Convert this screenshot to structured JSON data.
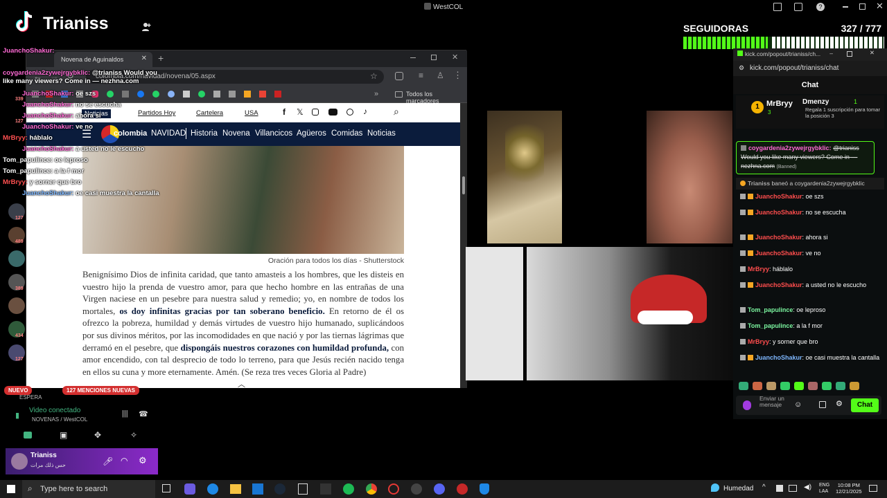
{
  "stream": {
    "channel_name": "Trianiss",
    "top_label": "WestCOL",
    "followers_label": "SEGUIDORAS",
    "followers_count": "327 / 777",
    "followers_progress": 0.42,
    "new_badge": "NUEVO",
    "mentions_badge": "127 MENCIONES NUEVAS",
    "overlay_chat": [
      {
        "user": "JuanchoShakur:",
        "text": ""
      },
      {
        "user": "coygardenia2zywejrgybklic:",
        "text": "@trianiss Would you like many viewers? Come in — nezhna.com"
      },
      {
        "user": "JuanchoShakur:",
        "text": "oe szs"
      },
      {
        "user": "JuanchoShakur:",
        "text": "no se escucha"
      },
      {
        "user": "JuanchoShakur:",
        "text": "ahora si"
      },
      {
        "user": "JuanchoShakur:",
        "text": "ve no"
      },
      {
        "user": "MrBryy:",
        "text": "háblalo"
      },
      {
        "user": "JuanchoShakur:",
        "text": "a usted no le escucho"
      },
      {
        "user": "Tom_papulince:",
        "text": "oe leproso"
      },
      {
        "user": "Tom_papulince:",
        "text": "a la f mor"
      },
      {
        "user": "MrBryy:",
        "text": "y sorner que bro"
      },
      {
        "user": "JuanchoShakur:",
        "text": "oe casi muestra la cantalla"
      }
    ],
    "viewer_counts": [
      "339",
      "127",
      "489",
      "127",
      "389",
      "434",
      "127"
    ]
  },
  "browser": {
    "tab_title": "Novena de Aguinaldos",
    "url": "colombia.com/navidad/novena/05.aspx",
    "all_bookmarks": "Todos los marcadores",
    "top_nav": [
      "Noticias",
      "Partidos Hoy",
      "Cartelera",
      "USA"
    ],
    "logo": "colombia",
    "main_nav": [
      "NAVIDAD",
      "Historia",
      "Novena",
      "Villancicos",
      "Agüeros",
      "Comidas",
      "Noticias"
    ],
    "caption": "Oración para todos los días - Shutterstock",
    "paragraph_1": "Benignísimo Dios de infinita caridad, que tanto amasteis a los hombres, que les disteis en vuestro hijo la prenda de vuestro amor, para que hecho hombre en las entrañas de una Virgen naciese en un pesebre para nuestra salud y remedio; yo, en nombre de todos los mortales, ",
    "bold_1": "os doy infinitas gracias por tan soberano beneficio.",
    "paragraph_2": " En retorno de él os ofrezco la pobreza, humildad y demás virtudes de vuestro hijo humanado, suplicándoos por sus divinos méritos, por las incomodidades en que nació y por las tiernas lágrimas que derramó en el pesebre, que ",
    "bold_2": "dispongáis nuestros corazones con humildad profunda,",
    "paragraph_3": " con amor encendido, con tal desprecio de todo lo terreno, para que Jesús recién nacido tenga en ellos su cuna y more eternamente. Amén. (Se reza tres veces Gloria al Padre)"
  },
  "kick": {
    "window_title": "kick.com/popout/trianiss/ch...",
    "url": "kick.com/popout/trianiss/chat",
    "header": "Chat",
    "sub_user": "MrBryy",
    "sub_count": "3",
    "gift_user": "Dmenzy",
    "gift_num": "1",
    "gift_text": "Regala 1 suscripción para tomar la posición 3",
    "banned_user": "coygardenia2zywejrgybklic:",
    "banned_text": "@trianiss Would you like many viewers? Come in — nezhna.com",
    "banned_tag": "(Banned)",
    "ban_notice_user": "Trianiss",
    "ban_notice_text": "baneó a coygardenia2zywejrgybklic",
    "messages": [
      {
        "user": "JuanchoShakur",
        "text": ": oe szs",
        "color": "#ff4d4d"
      },
      {
        "user": "JuanchoShakur",
        "text": ": no se escucha",
        "color": "#ff4d4d"
      },
      {
        "user": "JuanchoShakur",
        "text": ": ahora si",
        "color": "#ff4d4d"
      },
      {
        "user": "JuanchoShakur",
        "text": ": ve no",
        "color": "#ff4d4d"
      },
      {
        "user": "MrBryy",
        "text": ": háblalo",
        "color": "#ff4d4d"
      },
      {
        "user": "JuanchoShakur",
        "text": ": a usted no le escucho",
        "color": "#ff4d4d"
      },
      {
        "user": "Tom_papulince",
        "text": ": oe leproso",
        "color": "#7cf7a0"
      },
      {
        "user": "Tom_papulince",
        "text": ": a la f mor",
        "color": "#7cf7a0"
      },
      {
        "user": "MrBryy",
        "text": ": y sorner que bro",
        "color": "#ff4d4d"
      },
      {
        "user": "JuanchoShakur",
        "text": ": oe casi muestra la cantalla",
        "color": "#7fb8ff"
      }
    ],
    "input_placeholder": "Enviar un mensaje",
    "send_label": "Chat",
    "accent": "#53fc18"
  },
  "discord": {
    "status": "Video conectado",
    "channel": "NOVENAS / WestCOL",
    "user": "Trianiss",
    "user_status": "حس ذلك مرات",
    "waiting": "ESPERA"
  },
  "taskbar": {
    "search_placeholder": "Type here to search",
    "weather": "Humedad",
    "lang": "ENG",
    "region": "LAA",
    "time": "10:08 PM",
    "date": "12/21/2025"
  }
}
